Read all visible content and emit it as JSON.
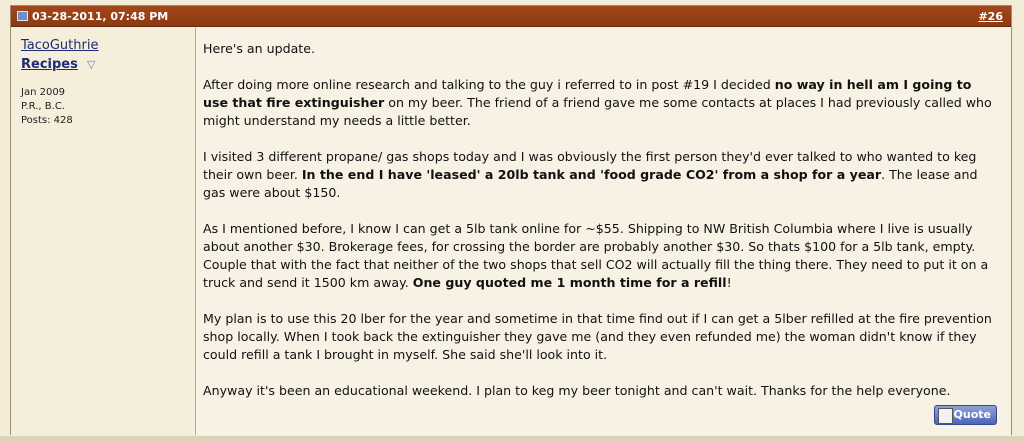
{
  "post": {
    "date": "03-28-2011, 07:48 PM",
    "number": "#26"
  },
  "user": {
    "name": "TacoGuthrie",
    "title": "Recipes",
    "join_date": "Jan 2009",
    "location": "P.R., B.C.",
    "posts": "Posts: 428"
  },
  "message": {
    "p1": "Here's an update.",
    "p2a": "After doing more online research and talking to the guy i referred to in post #19 I decided ",
    "p2b": "no way in hell am I going to use that fire extinguisher",
    "p2c": " on my beer. The friend of a friend gave me some contacts at places I had previously called who might understand my needs a little better.",
    "p3a": "I visited 3 different propane/ gas shops today and I was obviously the first person they'd ever talked to who wanted to keg their own beer. ",
    "p3b": "In the end I have 'leased' a 20lb tank and 'food grade CO2' from a shop for a year",
    "p3c": ". The lease and gas were about $150.",
    "p4a": "As I mentioned before, I know I can get a 5lb tank online for ~$55. Shipping to NW British Columbia where I live is usually about another $30. Brokerage fees, for crossing the border are probably another $30. So thats $100 for a 5lb tank, empty. Couple that with the fact that neither of the two shops that sell CO2 will actually fill the thing there. They need to put it on a truck and send it 1500 km away. ",
    "p4b": "One guy quoted me 1 month time for a refill",
    "p4c": "!",
    "p5": "My plan is to use this 20 lber for the year and sometime in that time find out if I can get a 5lber refilled at the fire prevention shop locally. When I took back the extinguisher they gave me (and they even refunded me) the woman didn't know if they could refill a tank I brought in myself. She said she'll look into it.",
    "p6": "Anyway it's been an educational weekend. I plan to keg my beer tonight and can't wait. Thanks for the help everyone."
  },
  "buttons": {
    "quote": "Quote"
  },
  "icons": {
    "post_status": "post-status-icon",
    "user_menu": "dropdown-arrow-icon",
    "quote": "quote-icon"
  }
}
